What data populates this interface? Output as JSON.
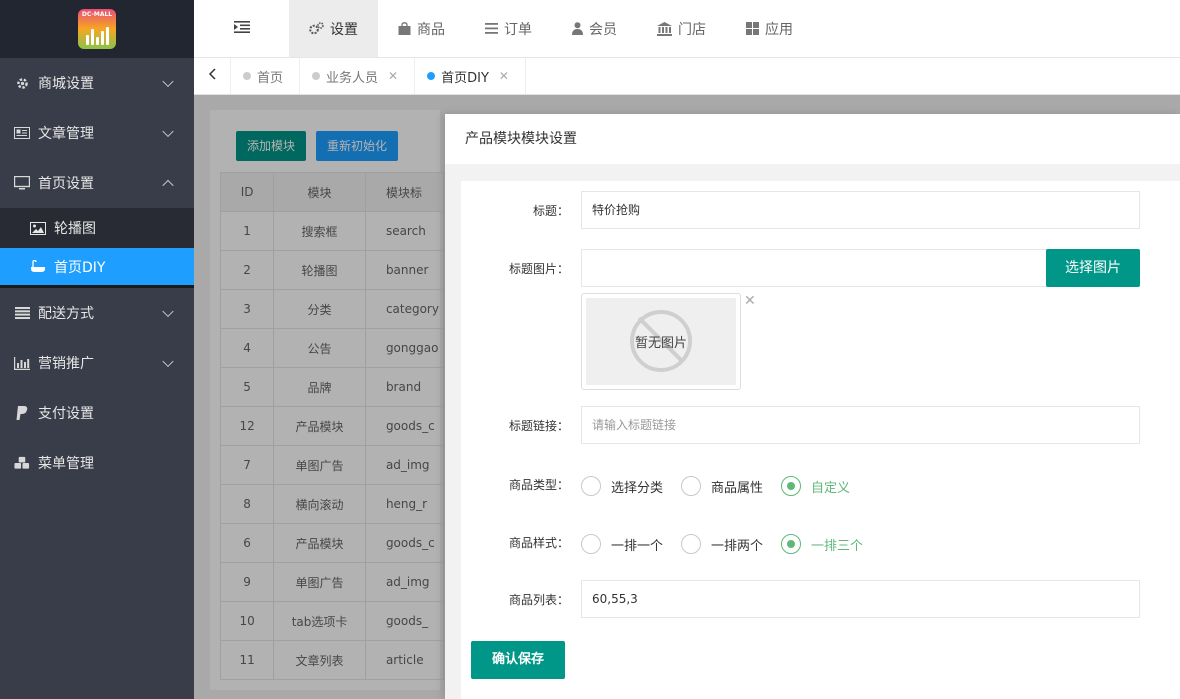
{
  "logo": {
    "text": "DC-MALL"
  },
  "sidebar": {
    "items": [
      {
        "label": "商城设置",
        "icon": "gear-icon"
      },
      {
        "label": "文章管理",
        "icon": "newspaper-icon"
      },
      {
        "label": "首页设置",
        "icon": "monitor-icon"
      },
      {
        "label": "配送方式",
        "icon": "list-icon"
      },
      {
        "label": "营销推广",
        "icon": "bar-chart-icon"
      },
      {
        "label": "支付设置",
        "icon": "paypal-icon"
      },
      {
        "label": "菜单管理",
        "icon": "cubes-icon"
      }
    ],
    "sub_items": [
      {
        "label": "轮播图",
        "icon": "image-icon"
      },
      {
        "label": "首页DIY",
        "icon": "bath-icon",
        "active": true
      }
    ]
  },
  "topbar": {
    "items": [
      {
        "label": "设置",
        "icon": "cogs-icon",
        "active": true
      },
      {
        "label": "商品",
        "icon": "shopping-bag-icon"
      },
      {
        "label": "订单",
        "icon": "list-icon"
      },
      {
        "label": "会员",
        "icon": "user-icon"
      },
      {
        "label": "门店",
        "icon": "bank-icon"
      },
      {
        "label": "应用",
        "icon": "grid-icon"
      }
    ]
  },
  "tabs": [
    {
      "label": "首页",
      "closable": false
    },
    {
      "label": "业务人员",
      "closable": true
    },
    {
      "label": "首页DIY",
      "closable": true,
      "active": true
    }
  ],
  "toolbar": {
    "add_label": "添加模块",
    "reset_label": "重新初始化"
  },
  "table": {
    "headers": [
      "ID",
      "模块",
      "模块标"
    ],
    "rows": [
      [
        "1",
        "搜索框",
        "search"
      ],
      [
        "2",
        "轮播图",
        "banner"
      ],
      [
        "3",
        "分类",
        "category"
      ],
      [
        "4",
        "公告",
        "gonggao"
      ],
      [
        "5",
        "品牌",
        "brand"
      ],
      [
        "12",
        "产品模块",
        "goods_c"
      ],
      [
        "7",
        "单图广告",
        "ad_img"
      ],
      [
        "8",
        "横向滚动",
        "heng_r"
      ],
      [
        "6",
        "产品模块",
        "goods_c"
      ],
      [
        "9",
        "单图广告",
        "ad_img"
      ],
      [
        "10",
        "tab选项卡",
        "goods_"
      ],
      [
        "11",
        "文章列表",
        "article"
      ]
    ]
  },
  "panel": {
    "title": "产品模块模块设置",
    "form": {
      "title_label": "标题：",
      "title_value": "特价抢购",
      "title_image_label": "标题图片：",
      "choose_image_label": "选择图片",
      "no_image_text": "暂无图片",
      "title_link_label": "标题链接：",
      "title_link_placeholder": "请输入标题链接",
      "goods_type_label": "商品类型：",
      "goods_type_options": [
        "选择分类",
        "商品属性",
        "自定义"
      ],
      "goods_type_selected": "自定义",
      "goods_style_label": "商品样式：",
      "goods_style_options": [
        "一排一个",
        "一排两个",
        "一排三个"
      ],
      "goods_style_selected": "一排三个",
      "goods_list_label": "商品列表：",
      "goods_list_value": "60,55,3",
      "save_label": "确认保存"
    }
  },
  "colors": {
    "primary_green": "#009688",
    "primary_blue": "#1e9fff",
    "sidebar_bg": "#393d49",
    "radio_checked": "#5fb878"
  }
}
